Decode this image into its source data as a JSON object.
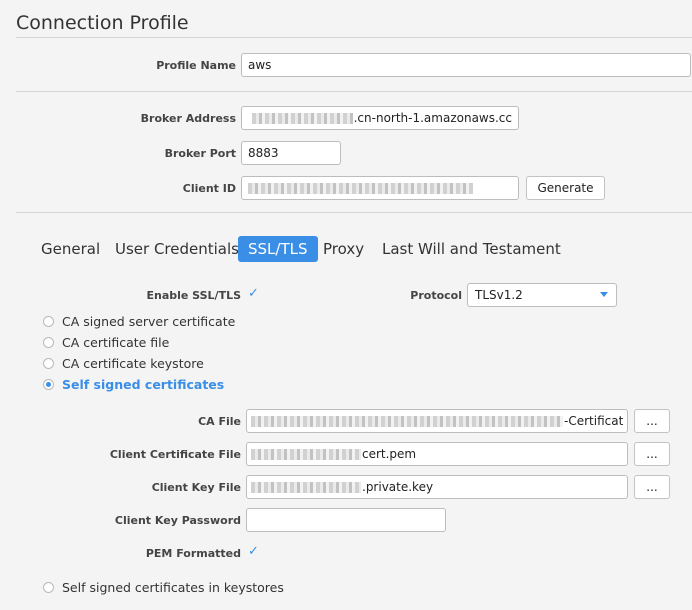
{
  "header": {
    "title": "Connection Profile"
  },
  "profile": {
    "name_label": "Profile Name",
    "name_value": "aws"
  },
  "broker": {
    "address_label": "Broker Address",
    "address_value": ".cn-north-1.amazonaws.cc",
    "port_label": "Broker Port",
    "port_value": "8883",
    "client_id_label": "Client ID",
    "generate_label": "Generate"
  },
  "tabs": [
    {
      "label": "General",
      "active": false
    },
    {
      "label": "User Credentials",
      "active": false
    },
    {
      "label": "SSL/TLS",
      "active": true
    },
    {
      "label": "Proxy",
      "active": false
    },
    {
      "label": "Last Will and Testament",
      "active": false
    }
  ],
  "ssl": {
    "enable_label": "Enable SSL/TLS",
    "enable_checked": true,
    "protocol_label": "Protocol",
    "protocol_value": "TLSv1.2",
    "options": [
      {
        "label": "CA signed server certificate",
        "selected": false
      },
      {
        "label": "CA certificate file",
        "selected": false
      },
      {
        "label": "CA certificate keystore",
        "selected": false
      },
      {
        "label": "Self signed certificates",
        "selected": true
      }
    ],
    "ca_file_label": "CA File",
    "ca_file_value": "-Certificat",
    "client_cert_label": "Client Certificate File",
    "client_cert_value": "cert.pem",
    "client_key_label": "Client Key File",
    "client_key_value": ".private.key",
    "client_key_password_label": "Client Key Password",
    "pem_label": "PEM Formatted",
    "pem_checked": true,
    "browse_label": "...",
    "keystore_option": "Self signed certificates in keystores"
  },
  "colors": {
    "accent": "#3a8ee6",
    "background": "#f4f4f4"
  }
}
